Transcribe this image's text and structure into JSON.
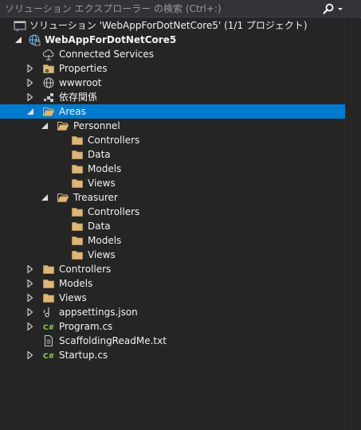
{
  "search": {
    "placeholder": "ソリューション エクスプローラー の検索 (Ctrl+:)"
  },
  "tree": {
    "solution": {
      "label": "ソリューション 'WebAppForDotNetCore5' (1/1 プロジェクト)",
      "icon": "solution-icon"
    },
    "project": {
      "label": "WebAppForDotNetCore5",
      "icon": "web-project-icon"
    },
    "items": {
      "connected_services": "Connected Services",
      "properties": "Properties",
      "wwwroot": "wwwroot",
      "dependencies": "依存関係",
      "areas": "Areas",
      "personnel": "Personnel",
      "personnel_controllers": "Controllers",
      "personnel_data": "Data",
      "personnel_models": "Models",
      "personnel_views": "Views",
      "treasurer": "Treasurer",
      "treasurer_controllers": "Controllers",
      "treasurer_data": "Data",
      "treasurer_models": "Models",
      "treasurer_views": "Views",
      "controllers": "Controllers",
      "models": "Models",
      "views": "Views",
      "appsettings": "appsettings.json",
      "program": "Program.cs",
      "scaffolding": "ScaffoldingReadMe.txt",
      "startup": "Startup.cs"
    },
    "selected": "Areas"
  },
  "colors": {
    "background": "#252526",
    "selection": "#007acc",
    "folder": "#dcb67a",
    "csharp": "#68217a",
    "text": "#f1f1f1"
  }
}
